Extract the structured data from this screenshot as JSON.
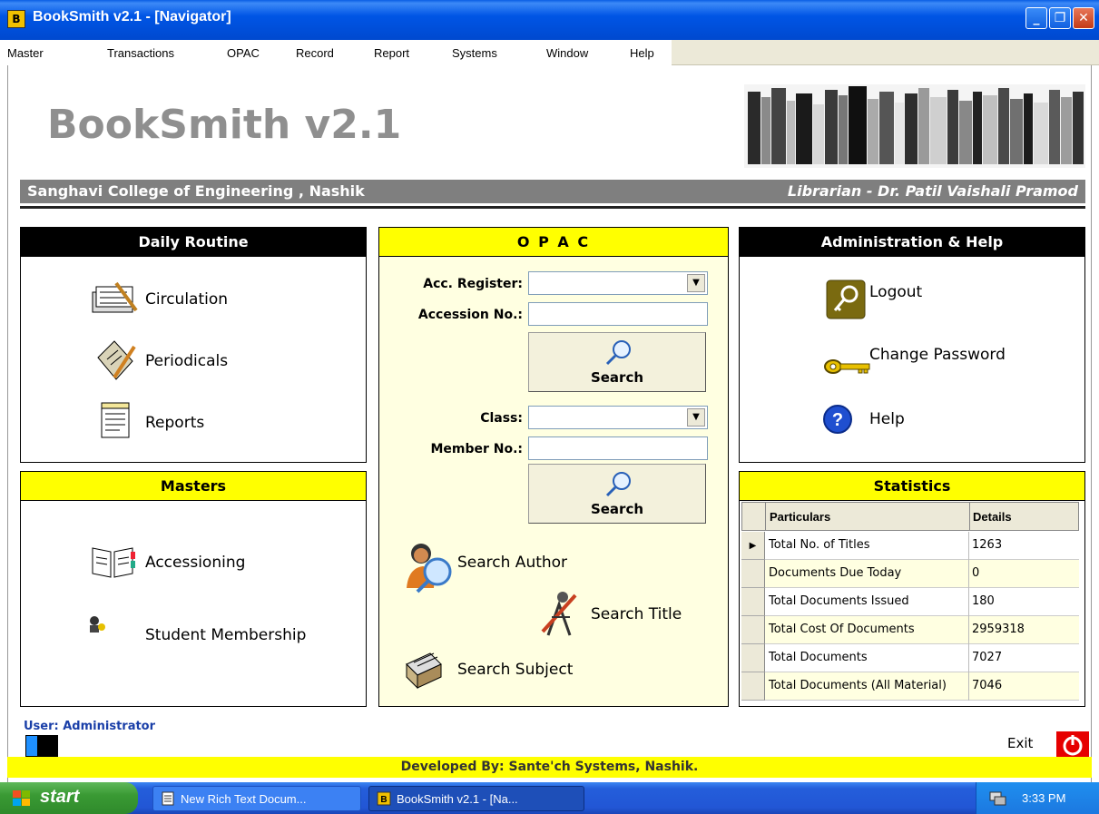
{
  "window": {
    "title": "BookSmith v2.1 - [Navigator]",
    "app_icon_glyph": "B"
  },
  "menu": [
    "Master",
    "Transactions",
    "OPAC",
    "Record",
    "Report",
    "Systems",
    "Window",
    "Help"
  ],
  "brand": {
    "name": "BookSmith v2.1",
    "college": "Sanghavi College of Engineering , Nashik",
    "librarian": "Librarian - Dr. Patil Vaishali Pramod"
  },
  "daily_routine": {
    "title": "Daily Routine",
    "items": [
      "Circulation",
      "Periodicals",
      "Reports"
    ]
  },
  "masters": {
    "title": "Masters",
    "items": [
      "Accessioning",
      "Student Membership"
    ]
  },
  "opac": {
    "title": "O P A C",
    "acc_register_label": "Acc. Register:",
    "accession_no_label": "Accession No.:",
    "class_label": "Class:",
    "member_no_label": "Member No.:",
    "search_label": "Search",
    "search_author": "Search Author",
    "search_title": "Search Title",
    "search_subject": "Search Subject"
  },
  "admin": {
    "title": "Administration & Help",
    "items": [
      "Logout",
      "Change Password",
      "Help"
    ]
  },
  "statistics": {
    "title": "Statistics",
    "headers": [
      "Particulars",
      "Details"
    ],
    "rows": [
      {
        "particular": "Total No. of Titles",
        "detail": "1263"
      },
      {
        "particular": "Documents Due Today",
        "detail": "0"
      },
      {
        "particular": "Total Documents Issued",
        "detail": "180"
      },
      {
        "particular": "Total Cost Of Documents",
        "detail": "2959318"
      },
      {
        "particular": "Total Documents",
        "detail": "7027"
      },
      {
        "particular": "Total Documents (All Material)",
        "detail": "7046"
      }
    ]
  },
  "user": "User: Administrator",
  "exit": "Exit",
  "footer": "Developed By: Sante'ch Systems, Nashik.",
  "taskbar": {
    "start": "start",
    "tasks": [
      "New Rich Text Docum...",
      "BookSmith v2.1 - [Na..."
    ],
    "clock": "3:33 PM"
  },
  "colors": {
    "accent_yellow": "#ffff00",
    "header_black": "#000000",
    "gray_bar": "#7f7f7f",
    "opac_bg": "#ffffe1",
    "xp_blue": "#0055e5"
  }
}
